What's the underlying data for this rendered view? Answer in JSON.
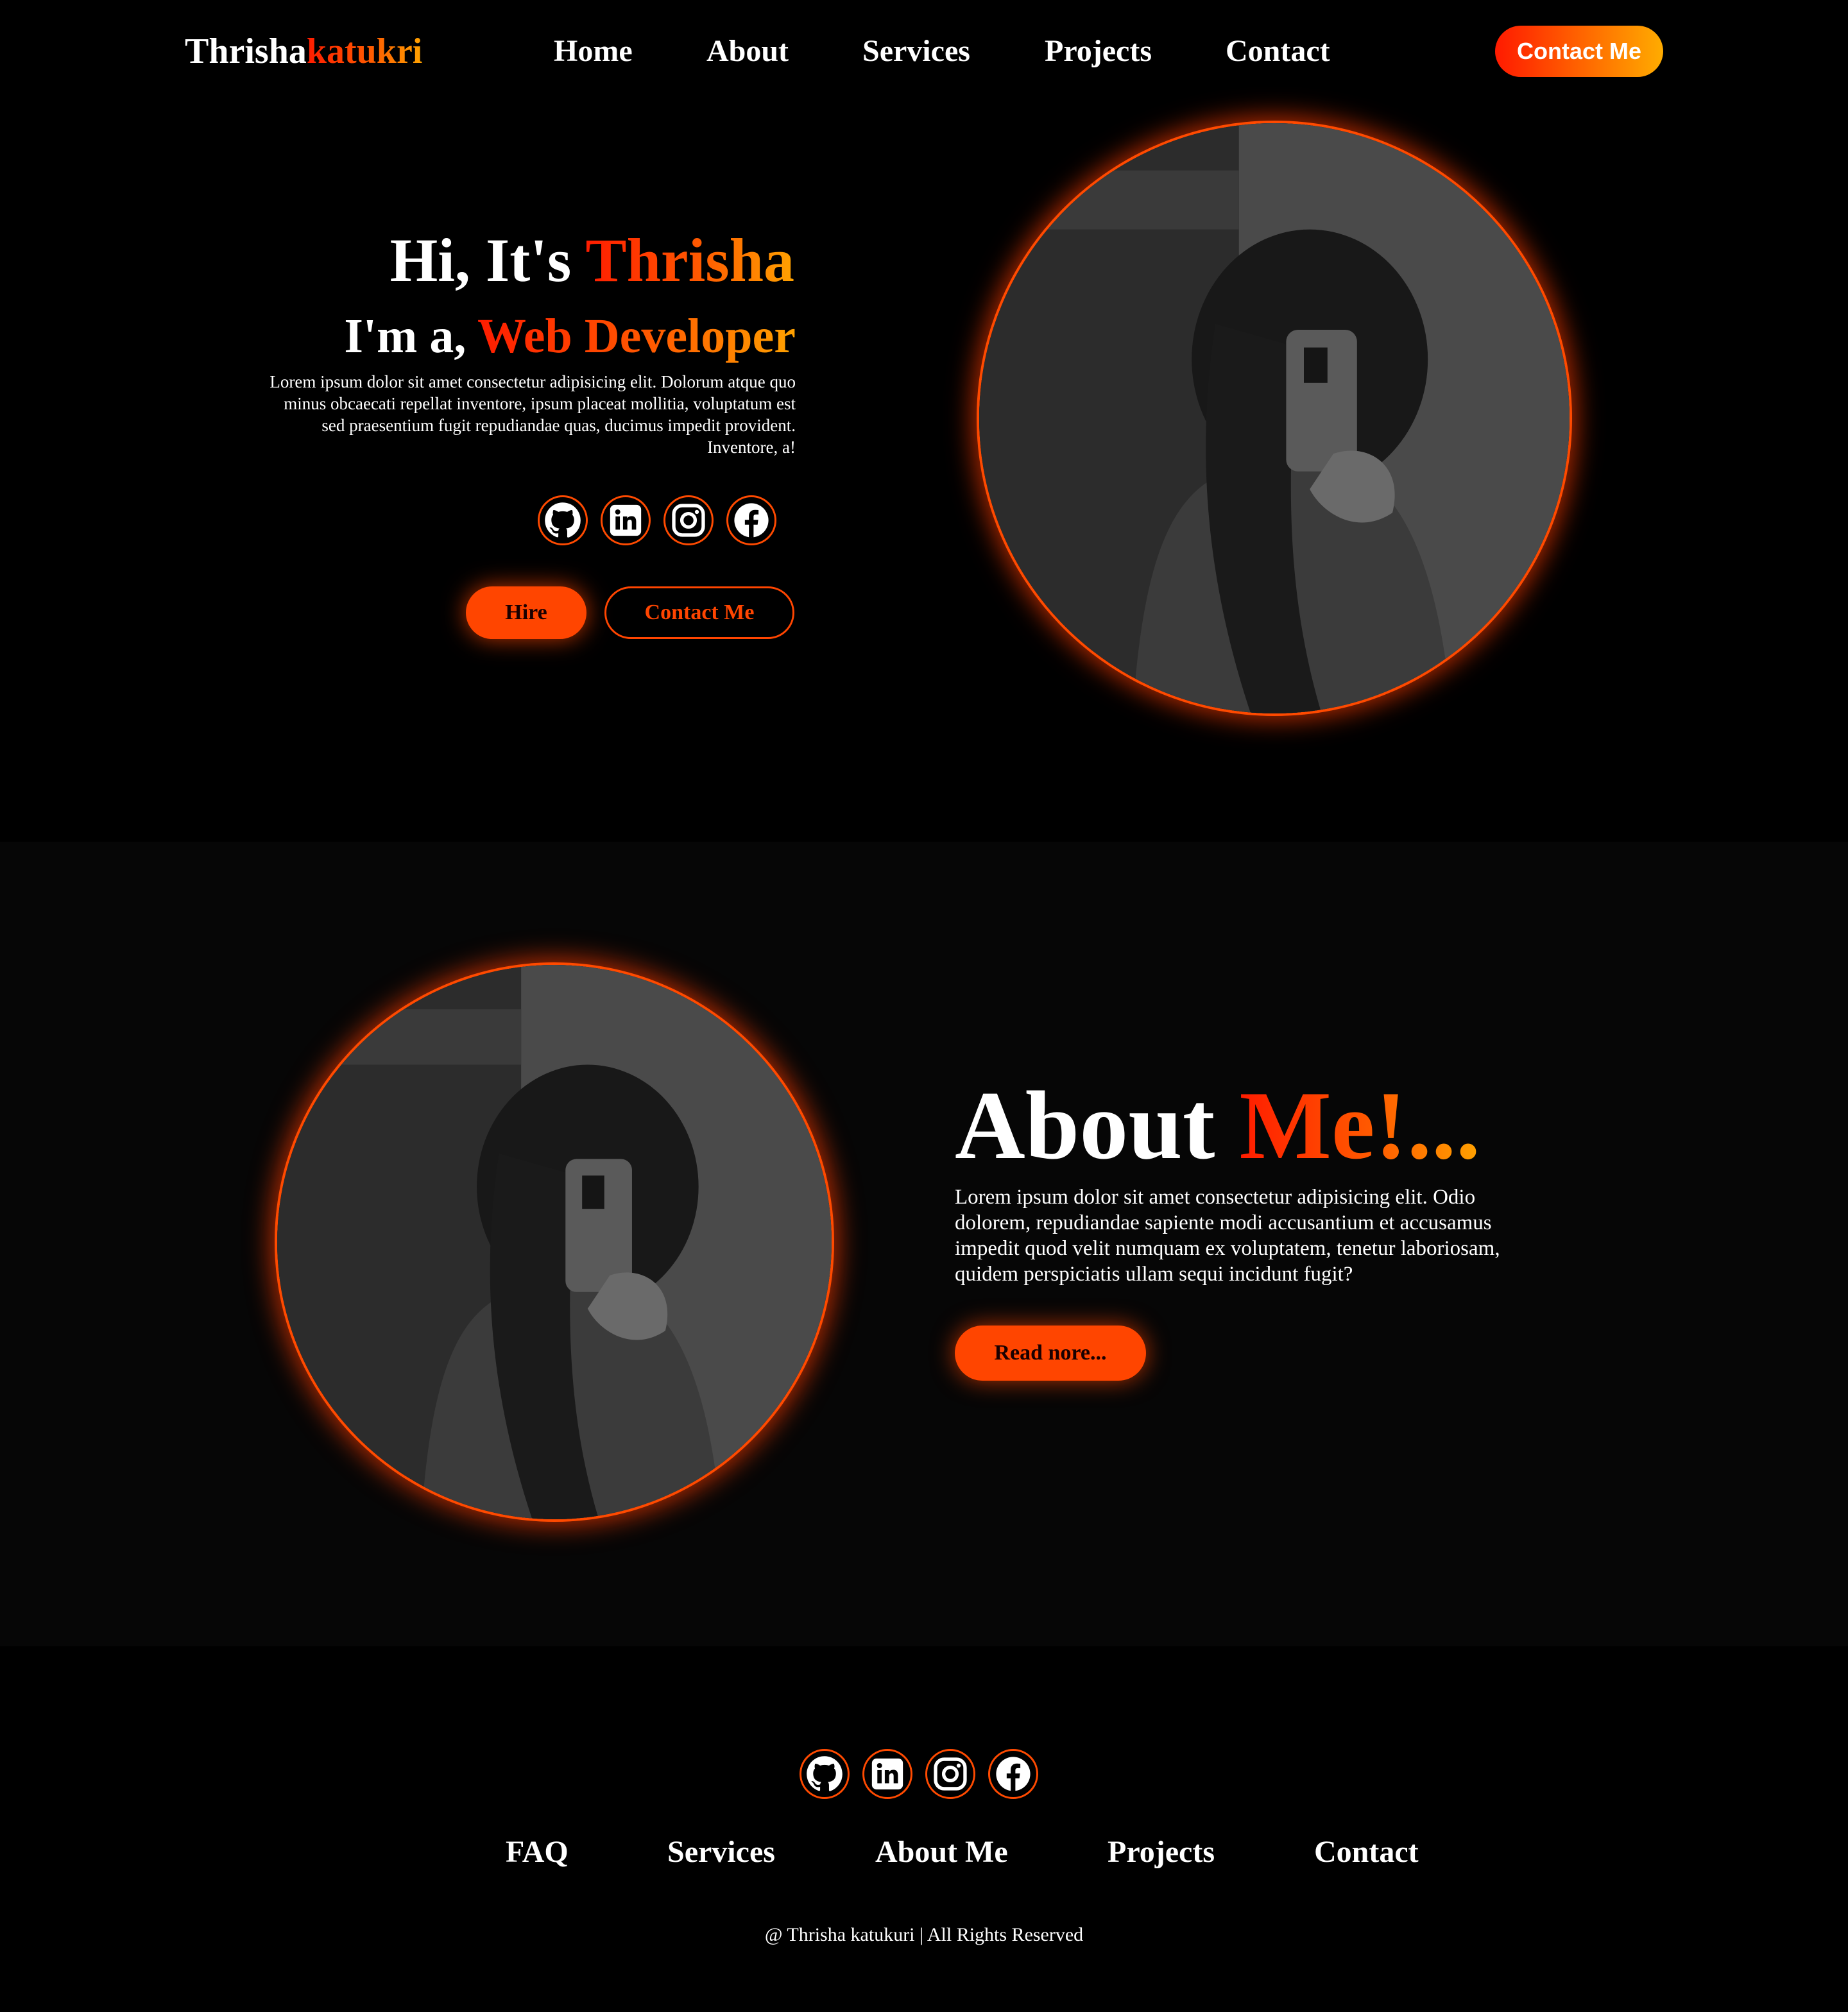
{
  "header": {
    "logo_first": "Thrisha",
    "logo_second": "katukri",
    "nav": [
      "Home",
      "About",
      "Services",
      "Projects",
      "Contact"
    ],
    "cta_label": "Contact Me"
  },
  "hero": {
    "greeting": "Hi, It's ",
    "name": "Thrisha",
    "role_prefix": "I'm a, ",
    "role": "Web Developer",
    "description": "Lorem ipsum dolor sit amet consectetur adipisicing elit. Dolorum atque quo minus obcaecati repellat inventore, ipsum placeat mollitia, voluptatum est sed praesentium fugit repudiandae quas, ducimus impedit provident. Inventore, a!",
    "socials": [
      "github-icon",
      "linkedin-icon",
      "instagram-icon",
      "facebook-icon"
    ],
    "hire_label": "Hire",
    "contact_label": "Contact Me"
  },
  "about": {
    "title_white": "About ",
    "title_accent": "Me!...",
    "text": "Lorem ipsum dolor sit amet consectetur adipisicing elit. Odio dolorem, repudiandae sapiente modi accusantium et accusamus impedit quod velit numquam ex voluptatem, tenetur laboriosam, quidem perspiciatis ullam sequi incidunt fugit?",
    "read_more_label": "Read nore..."
  },
  "footer": {
    "socials": [
      "github-icon",
      "linkedin-icon",
      "instagram-icon",
      "facebook-icon"
    ],
    "nav": [
      "FAQ",
      "Services",
      "About Me",
      "Projects",
      "Contact"
    ],
    "copyright": "@ Thrisha katukuri | All Rights Reserved"
  },
  "colors": {
    "accent": "#ff4500",
    "gradient_start": "#ff1c00",
    "gradient_end": "#ffa200",
    "background": "#000000",
    "section_background": "#060606"
  }
}
